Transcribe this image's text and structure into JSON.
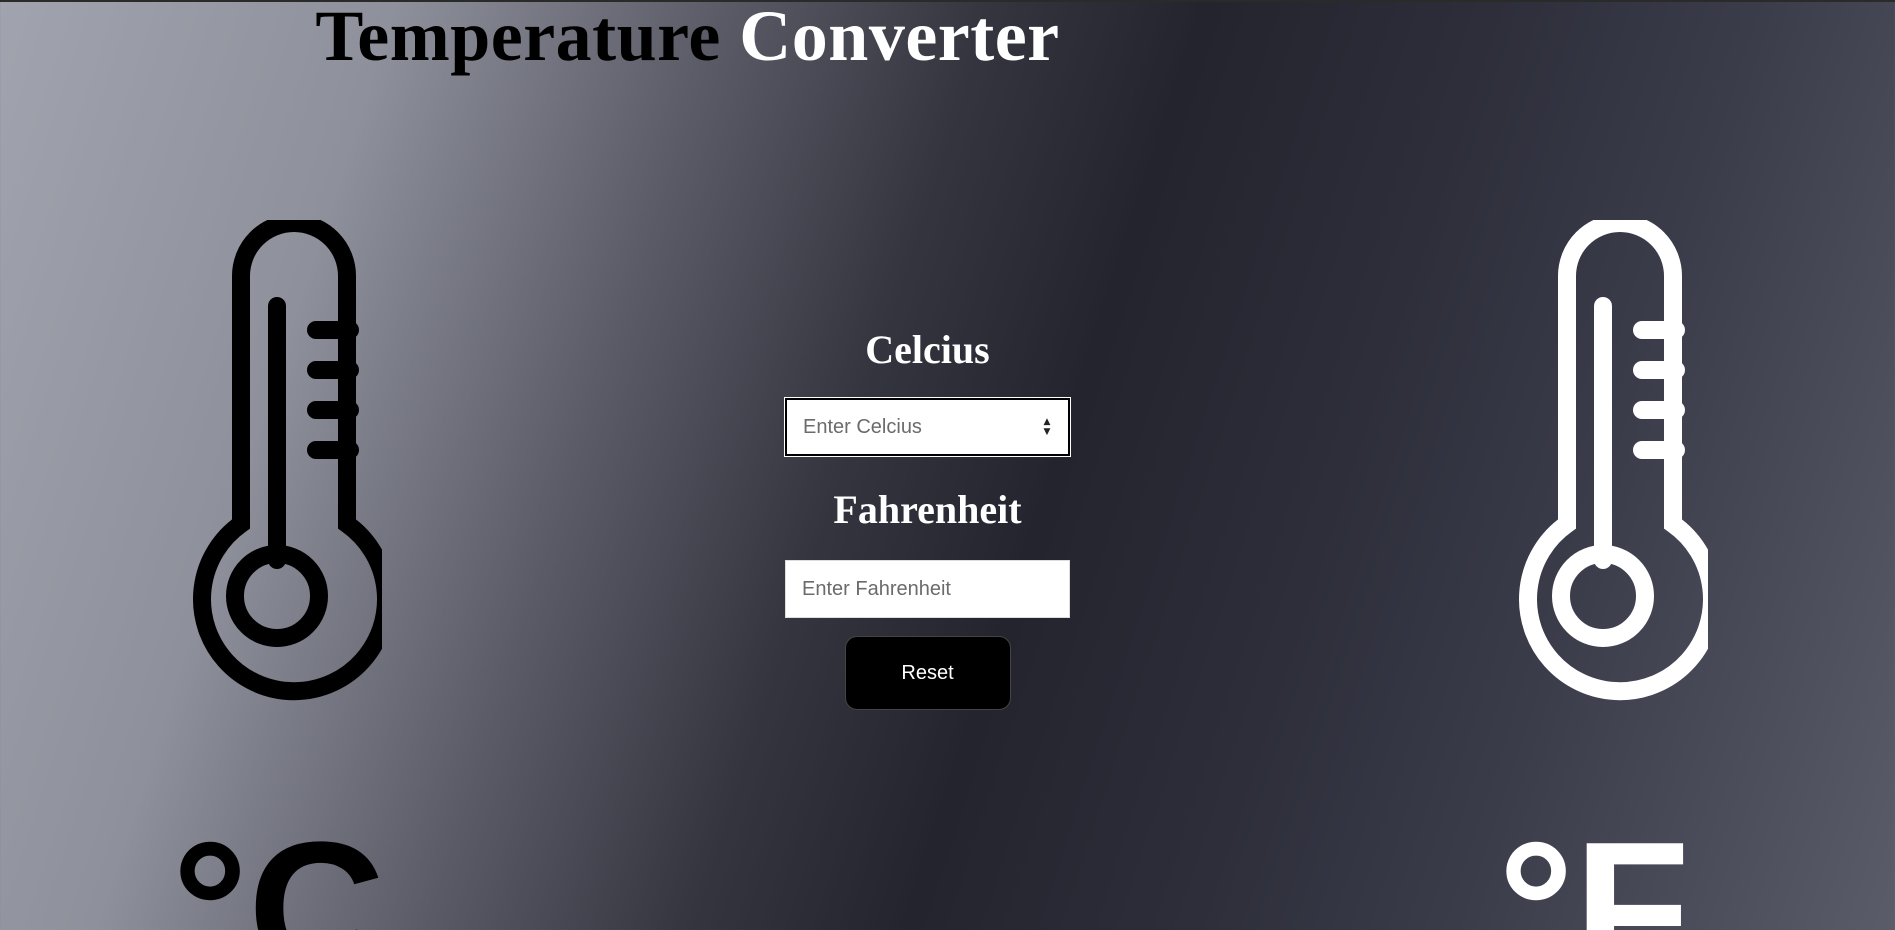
{
  "header": {
    "title_part1": "Temperature",
    "title_part2": "Converter"
  },
  "converter": {
    "celsius_label": "Celcius",
    "celsius_placeholder": "Enter Celcius",
    "fahrenheit_label": "Fahrenheit",
    "fahrenheit_placeholder": "Enter Fahrenheit",
    "reset_label": "Reset"
  },
  "decor": {
    "left_unit": "°C",
    "right_unit": "°F",
    "left_icon": "thermometer-icon",
    "right_icon": "thermometer-icon",
    "left_color": "#000000",
    "right_color": "#ffffff"
  }
}
